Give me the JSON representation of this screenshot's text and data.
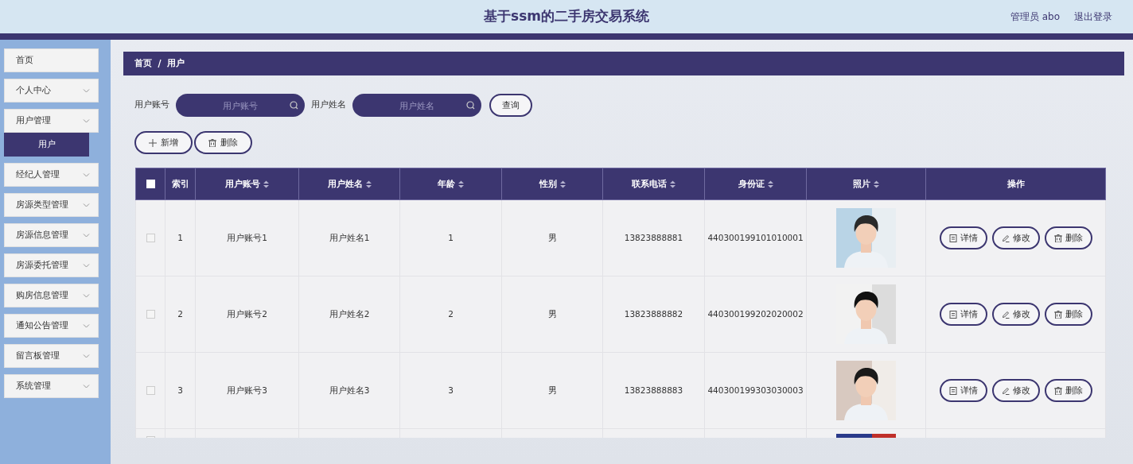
{
  "header": {
    "title": "基于ssm的二手房交易系统",
    "user": "管理员 abo",
    "logout": "退出登录"
  },
  "sidebar": {
    "items": [
      {
        "label": "首页",
        "kind": "link"
      },
      {
        "label": "个人中心",
        "kind": "menu"
      },
      {
        "label": "用户管理",
        "kind": "menu",
        "children": [
          {
            "label": "用户",
            "selected": true
          }
        ]
      },
      {
        "label": "经纪人管理",
        "kind": "menu"
      },
      {
        "label": "房源类型管理",
        "kind": "menu"
      },
      {
        "label": "房源信息管理",
        "kind": "menu"
      },
      {
        "label": "房源委托管理",
        "kind": "menu"
      },
      {
        "label": "购房信息管理",
        "kind": "menu"
      },
      {
        "label": "通知公告管理",
        "kind": "menu"
      },
      {
        "label": "留言板管理",
        "kind": "menu"
      },
      {
        "label": "系统管理",
        "kind": "menu"
      }
    ]
  },
  "breadcrumb": [
    "首页",
    "用户"
  ],
  "search": {
    "fields": [
      {
        "label": "用户账号",
        "placeholder": "用户账号"
      },
      {
        "label": "用户姓名",
        "placeholder": "用户姓名"
      }
    ],
    "button": "查询"
  },
  "actions": [
    {
      "label": "新增",
      "kind": "add"
    },
    {
      "label": "删除",
      "kind": "delete"
    }
  ],
  "table": {
    "select_all": false,
    "columns": [
      {
        "label": "索引",
        "sortable": false
      },
      {
        "label": "用户账号",
        "sortable": true
      },
      {
        "label": "用户姓名",
        "sortable": true
      },
      {
        "label": "年龄",
        "sortable": true
      },
      {
        "label": "性别",
        "sortable": true
      },
      {
        "label": "联系电话",
        "sortable": true
      },
      {
        "label": "身份证",
        "sortable": true
      },
      {
        "label": "照片",
        "sortable": true
      },
      {
        "label": "操作",
        "sortable": false
      }
    ],
    "rows": [
      {
        "selected": false,
        "cells": [
          "1",
          "用户账号1",
          "用户姓名1",
          "1",
          "男",
          "13823888881",
          "440300199101010001"
        ],
        "photo": {
          "kind": "picture"
        },
        "buttons": [
          {
            "label": "详情",
            "kind": "detail"
          },
          {
            "label": "修改",
            "kind": "edit"
          },
          {
            "label": "删除",
            "kind": "delete"
          }
        ]
      },
      {
        "selected": false,
        "cells": [
          "2",
          "用户账号2",
          "用户姓名2",
          "2",
          "男",
          "13823888882",
          "440300199202020002"
        ],
        "photo": {
          "kind": "picture"
        },
        "buttons": [
          {
            "label": "详情",
            "kind": "detail"
          },
          {
            "label": "修改",
            "kind": "edit"
          },
          {
            "label": "删除",
            "kind": "delete"
          }
        ]
      },
      {
        "selected": false,
        "cells": [
          "3",
          "用户账号3",
          "用户姓名3",
          "3",
          "男",
          "13823888883",
          "440300199303030003"
        ],
        "photo": {
          "kind": "picture"
        },
        "buttons": [
          {
            "label": "详情",
            "kind": "detail"
          },
          {
            "label": "修改",
            "kind": "edit"
          },
          {
            "label": "删除",
            "kind": "delete"
          }
        ]
      },
      {
        "selected": false,
        "photo": {
          "kind": "picture"
        }
      }
    ]
  }
}
